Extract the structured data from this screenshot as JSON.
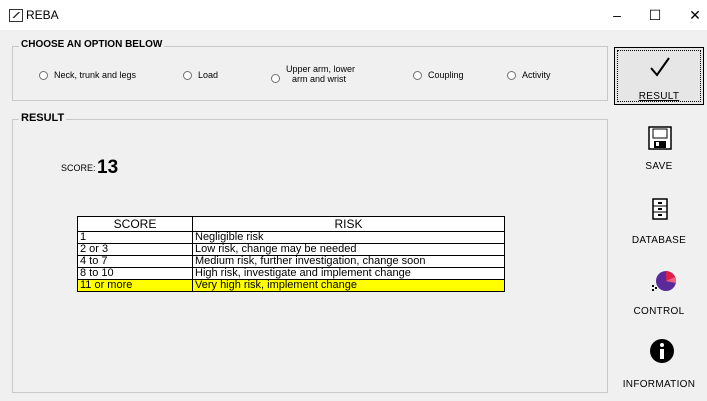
{
  "window": {
    "title": "REBA",
    "minimize": "–",
    "maximize": "☐",
    "close": "✕"
  },
  "options": {
    "title": "CHOOSE AN OPTION BELOW",
    "items": [
      {
        "label": "Neck, trunk and legs"
      },
      {
        "label": "Load"
      },
      {
        "label_line1": "Upper arm, lower",
        "label_line2": "arm and wrist"
      },
      {
        "label": "Coupling"
      },
      {
        "label": "Activity"
      }
    ]
  },
  "result": {
    "title": "RESULT",
    "score_label": "SCORE:",
    "score_value": "13"
  },
  "risk_table": {
    "headers": [
      "SCORE",
      "RISK"
    ],
    "rows": [
      {
        "score": "1",
        "risk": "Negligible risk"
      },
      {
        "score": "2 or 3",
        "risk": "Low risk, change may be needed"
      },
      {
        "score": "4 to 7",
        "risk": "Medium risk, further investigation, change soon"
      },
      {
        "score": "8 to 10",
        "risk": "High risk, investigate and implement change"
      },
      {
        "score": "11 or more",
        "risk": "Very high risk, implement change"
      }
    ],
    "highlight_color": "#ffff00"
  },
  "sidebar": {
    "result": "RESULT",
    "save": "SAVE",
    "database": "DATABASE",
    "control": "CONTROL",
    "information": "INFORMATION"
  }
}
